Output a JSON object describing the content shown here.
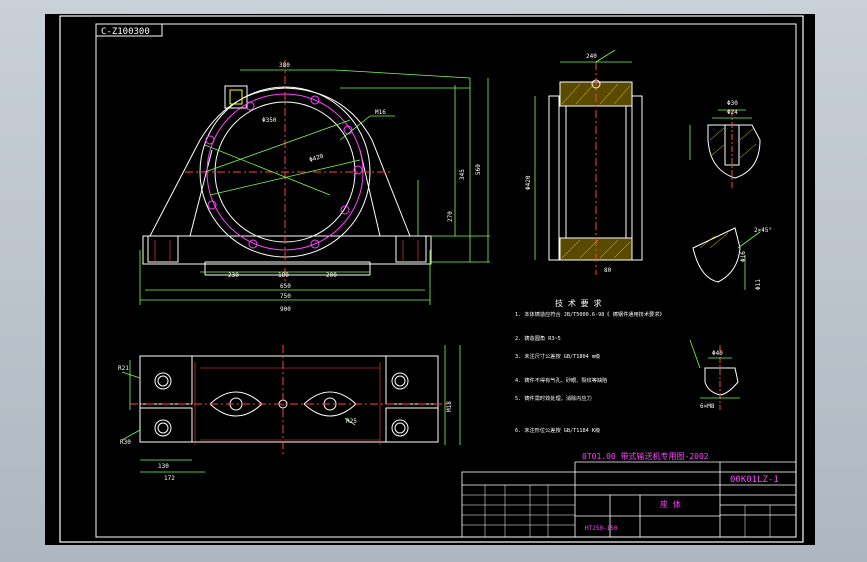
{
  "drawing_code": "C-Z100300",
  "title_block": {
    "project": "0T01.00 带式输送机专用图-2002",
    "drawing_no": "00K01LZ-1",
    "part_name": "座 体",
    "material": "HT250-150"
  },
  "notes_heading": "技 术 要 求",
  "notes": [
    "1. 本体铸造应符合 JB/T5000.6-98《 铸钢件通用技术要求》",
    "2. 铸造圆角 R3~5",
    "3. 未注尺寸公差按 GB/T1804 m级",
    "4. 铸件不得有气孔、砂眼、裂纹等缺陷",
    "5. 铸件需时效处理，消除内应力",
    "6. 未注形位公差按 GB/T1184 K级"
  ],
  "front_dims": [
    "380",
    "560",
    "345",
    "270",
    "230",
    "180",
    "200",
    "650",
    "750",
    "900",
    "Φ420",
    "Φ350",
    "M16"
  ],
  "section_dims": [
    "240",
    "Φ420",
    "80"
  ],
  "plan_dims": [
    "R21",
    "R30",
    "130",
    "172",
    "R25",
    "M18"
  ],
  "detail_dims": [
    "Φ30",
    "Φ24",
    "Φ16",
    "Φ11",
    "2×45°",
    "Φ40",
    "6×M8"
  ]
}
